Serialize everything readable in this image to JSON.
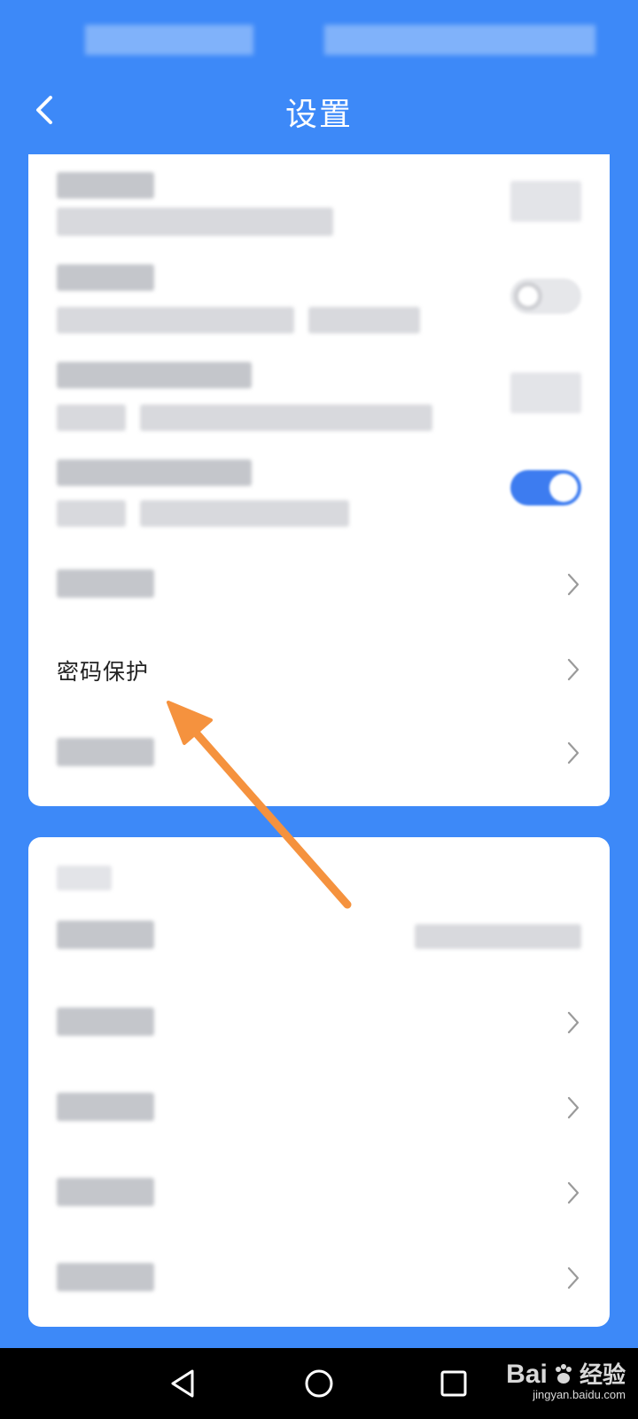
{
  "header": {
    "title": "设置",
    "back_icon": "chevron-left-icon"
  },
  "settings_card": {
    "password_protection_label": "密码保护"
  },
  "navbar": {
    "back_icon": "triangle-back-icon",
    "home_icon": "circle-home-icon",
    "recents_icon": "square-recents-icon"
  },
  "watermark": {
    "brand": "Bai",
    "brand_suffix": "经验",
    "url": "jingyan.baidu.com"
  },
  "colors": {
    "background": "#3d89f8",
    "card": "#ffffff",
    "arrow": "#f5923e",
    "toggle_on": "#3d7cf0"
  }
}
